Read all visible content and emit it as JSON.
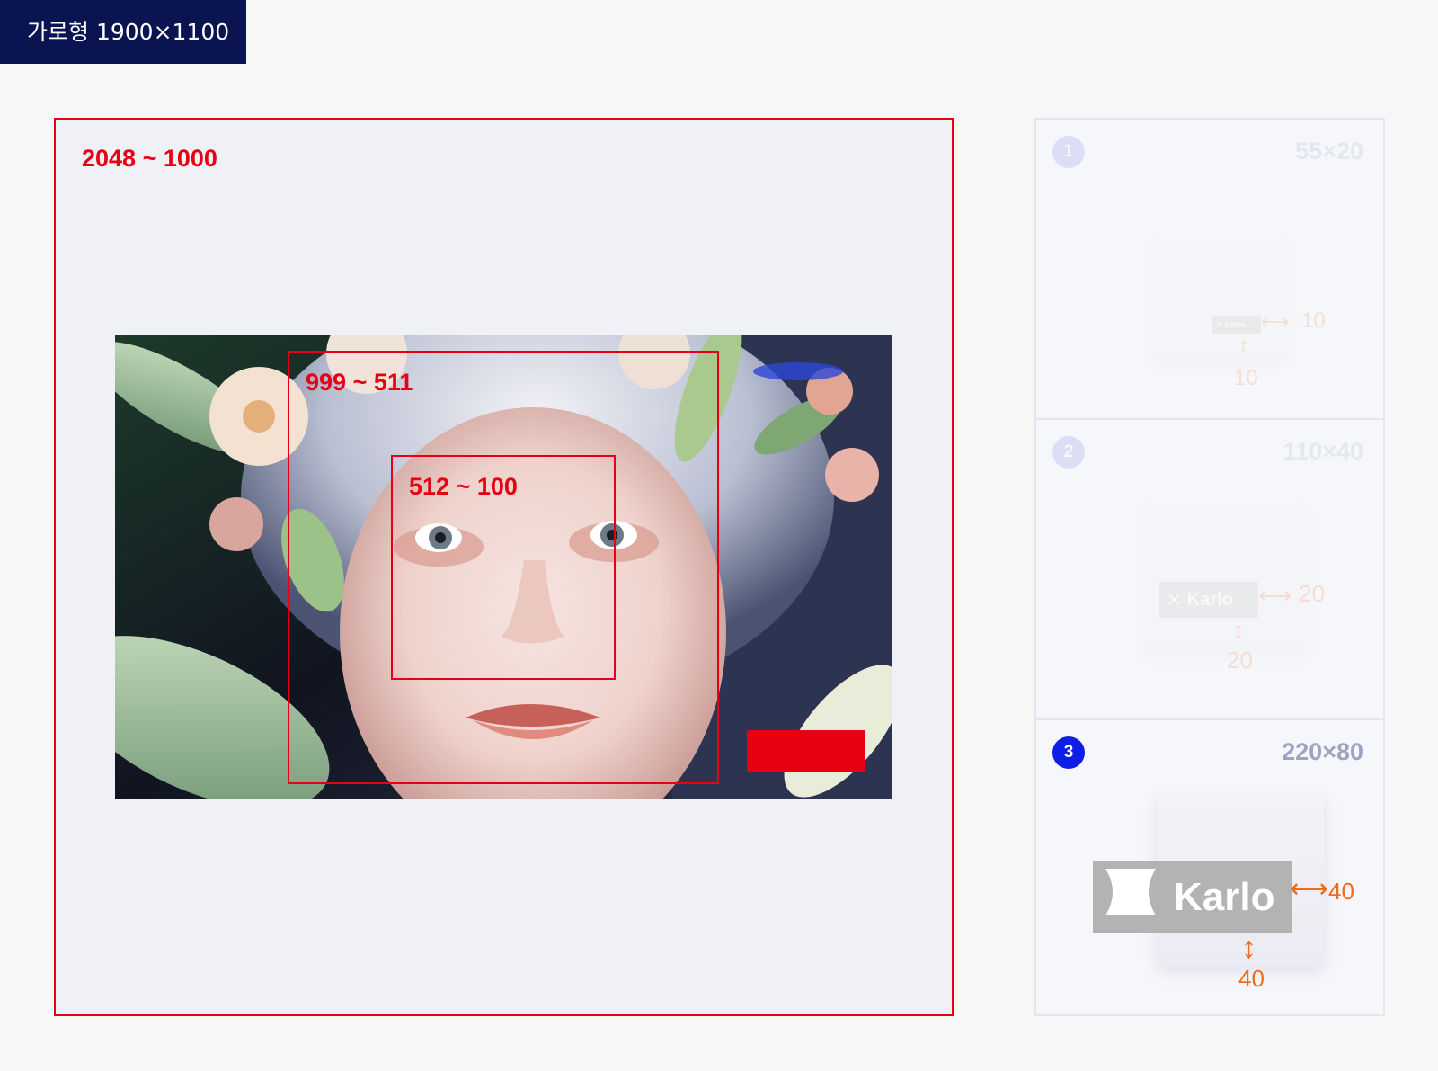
{
  "header": {
    "title": "가로형 1900×1100"
  },
  "main": {
    "outer_label": "2048 ~ 1000",
    "mid_label": "999 ~ 511",
    "inner_label": "512 ~ 100"
  },
  "steps": [
    {
      "num": "1",
      "size": "55×20",
      "logo": "Karlo",
      "h_gap": "10",
      "v_gap": "10",
      "active": false
    },
    {
      "num": "2",
      "size": "110×40",
      "logo": "Karlo",
      "h_gap": "20",
      "v_gap": "20",
      "active": false
    },
    {
      "num": "3",
      "size": "220×80",
      "logo": "Karlo",
      "h_gap": "40",
      "v_gap": "40",
      "active": true
    }
  ],
  "colors": {
    "header_bg": "#0a1450",
    "accent_red": "#e60012",
    "step_active": "#0f1ee6",
    "step_inactive": "#c9ccf2",
    "gap_orange": "#f26a1b"
  }
}
